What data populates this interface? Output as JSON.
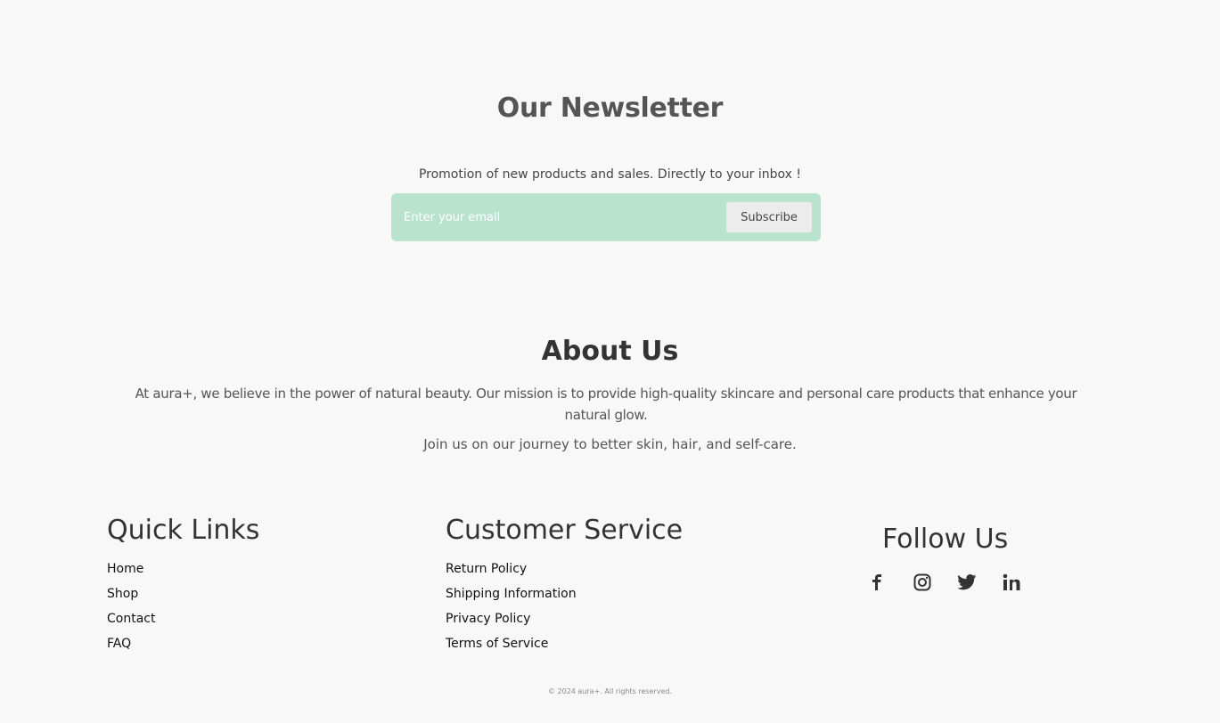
{
  "newsletter": {
    "title": "Our Newsletter",
    "subtitle": "Promotion of new products and sales. Directly to your inbox !",
    "email_placeholder": "Enter your email",
    "subscribe_label": "Subscribe"
  },
  "about": {
    "title": "About Us",
    "paragraph1": "At aura+, we believe in the power of natural beauty. Our mission is to provide high-quality skincare and personal care products that enhance your natural glow.",
    "paragraph2": "Join us on our journey to better skin, hair, and self-care."
  },
  "footer": {
    "quick_links": {
      "heading": "Quick Links",
      "items": [
        "Home",
        "Shop",
        "Contact",
        "FAQ"
      ]
    },
    "customer_service": {
      "heading": "Customer Service",
      "items": [
        "Return Policy",
        "Shipping Information",
        "Privacy Policy",
        "Terms of Service"
      ]
    },
    "follow_us": {
      "heading": "Follow Us",
      "icons": [
        "facebook-icon",
        "instagram-icon",
        "twitter-icon",
        "linkedin-icon"
      ]
    },
    "copyright": "© 2024 aura+. All rights reserved."
  },
  "colors": {
    "background": "#f8f8f8",
    "subscribe_box": "#b9e2cf",
    "subscribe_button": "#ececec"
  }
}
